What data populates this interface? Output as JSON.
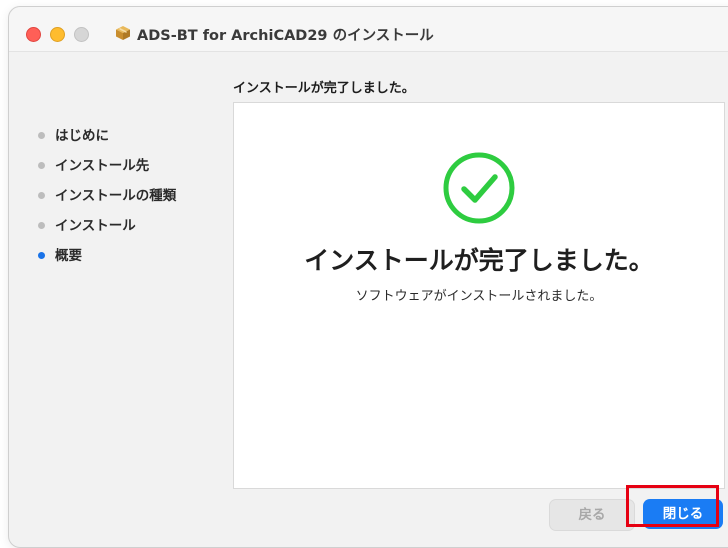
{
  "window": {
    "title": "ADS-BT for ArchiCAD29 のインストール",
    "traffic_lights": [
      "close",
      "minimize",
      "maximize"
    ]
  },
  "step_heading": "インストールが完了しました。",
  "sidebar": {
    "items": [
      {
        "label": "はじめに",
        "active": false
      },
      {
        "label": "インストール先",
        "active": false
      },
      {
        "label": "インストールの種類",
        "active": false
      },
      {
        "label": "インストール",
        "active": false
      },
      {
        "label": "概要",
        "active": true
      }
    ]
  },
  "content": {
    "icon": "checkmark-circle-icon",
    "main_message": "インストールが完了しました。",
    "sub_message": "ソフトウェアがインストールされました。"
  },
  "buttons": {
    "back_label": "戻る",
    "close_label": "閉じる"
  },
  "colors": {
    "accent": "#1a7cf4",
    "success": "#2ecc40",
    "highlight": "#e60012"
  }
}
